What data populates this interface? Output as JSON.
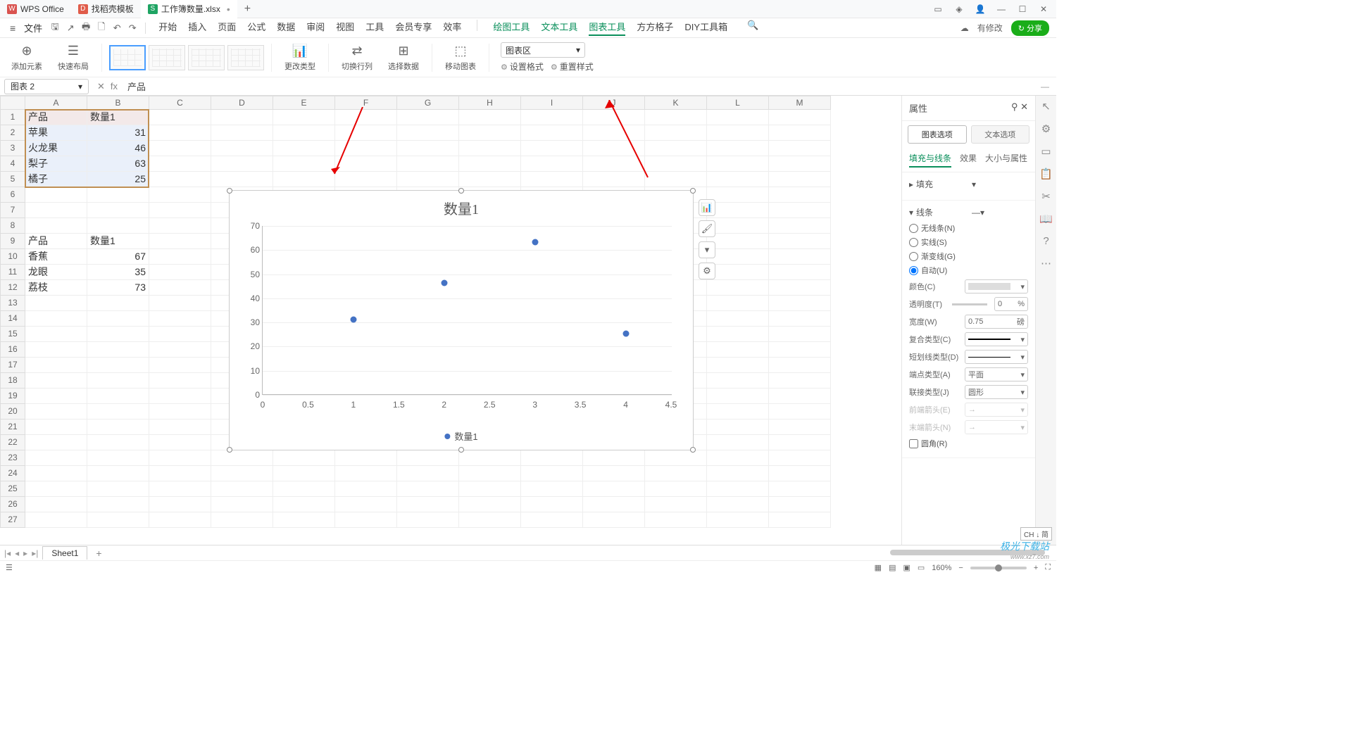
{
  "titlebar": {
    "app": "WPS Office",
    "tab_templates": "找稻壳模板",
    "tab_workbook": "工作簿数量.xlsx",
    "add": "+"
  },
  "menubar": {
    "file": "文件",
    "tabs": [
      "开始",
      "插入",
      "页面",
      "公式",
      "数据",
      "审阅",
      "视图",
      "工具",
      "会员专享",
      "效率"
    ],
    "context_tabs": [
      "绘图工具",
      "文本工具",
      "图表工具",
      "方方格子",
      "DIY工具箱"
    ],
    "active_context": "图表工具",
    "modified": "有修改",
    "share": "分享"
  },
  "ribbon": {
    "add_element": "添加元素",
    "quick_layout": "快速布局",
    "change_type": "更改类型",
    "switch_rowcol": "切换行列",
    "select_data": "选择数据",
    "move_chart": "移动图表",
    "chart_area_label": "图表区",
    "set_format": "设置格式",
    "reset_style": "重置样式"
  },
  "formulabar": {
    "name": "图表 2",
    "fx": "fx",
    "value": "产品"
  },
  "columns": [
    "A",
    "B",
    "C",
    "D",
    "E",
    "F",
    "G",
    "H",
    "I",
    "J",
    "K",
    "L",
    "M"
  ],
  "rows_count": 27,
  "cells": {
    "t1": {
      "h1": "产品",
      "h2": "数量1",
      "r": [
        [
          "苹果",
          "31"
        ],
        [
          "火龙果",
          "46"
        ],
        [
          "梨子",
          "63"
        ],
        [
          "橘子",
          "25"
        ]
      ]
    },
    "t2": {
      "h1": "产品",
      "h2": "数量1",
      "r": [
        [
          "香蕉",
          "67"
        ],
        [
          "龙眼",
          "35"
        ],
        [
          "荔枝",
          "73"
        ]
      ]
    }
  },
  "chart_data": {
    "type": "scatter",
    "title": "数量1",
    "series": [
      {
        "name": "数量1",
        "x": [
          1,
          2,
          3,
          4
        ],
        "y": [
          31,
          46,
          63,
          25
        ]
      }
    ],
    "legend": "数量1",
    "yticks": [
      0,
      10,
      20,
      30,
      40,
      50,
      60,
      70
    ],
    "xticks": [
      0,
      0.5,
      1,
      1.5,
      2,
      2.5,
      3,
      3.5,
      4,
      4.5
    ],
    "ylim": [
      0,
      70
    ],
    "xlim": [
      0,
      4.5
    ]
  },
  "prop": {
    "title": "属性",
    "tab_chart": "图表选项",
    "tab_text": "文本选项",
    "sub_fill": "填充与线条",
    "sub_effect": "效果",
    "sub_size": "大小与属性",
    "fill_head": "填充",
    "line_head": "线条",
    "line_none": "无线条(N)",
    "line_solid": "实线(S)",
    "line_grad": "渐变线(G)",
    "line_auto": "自动(U)",
    "color": "颜色(C)",
    "transparency": "透明度(T)",
    "transparency_val": "0",
    "transparency_unit": "%",
    "width": "宽度(W)",
    "width_val": "0.75",
    "width_unit": "磅",
    "compound": "复合类型(C)",
    "dash": "短划线类型(D)",
    "cap": "端点类型(A)",
    "cap_val": "平面",
    "join": "联接类型(J)",
    "join_val": "圆形",
    "arrow_start": "前端箭头(E)",
    "arrow_end": "末端箭头(N)",
    "round": "圆角(R)"
  },
  "sheettabs": {
    "sheet1": "Sheet1"
  },
  "statusbar": {
    "ime": "CH ↓ 简",
    "zoom": "160%"
  },
  "watermark": {
    "name": "极光下载站",
    "url": "www.xz7.com"
  }
}
